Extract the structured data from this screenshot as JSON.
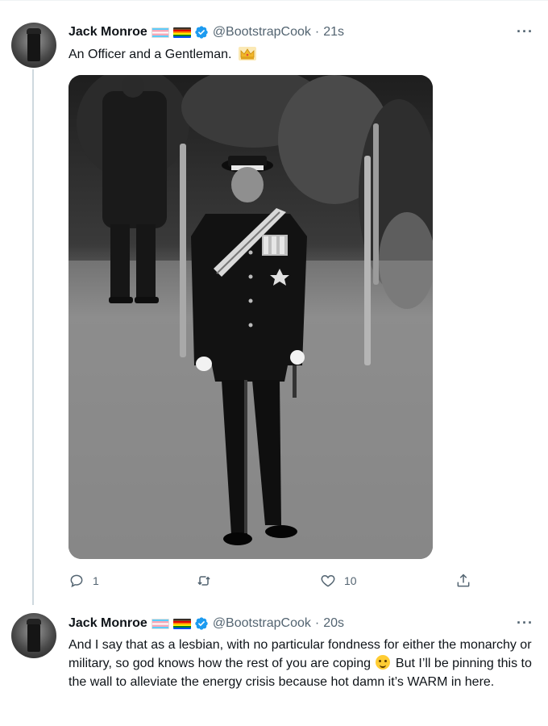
{
  "tweets": [
    {
      "author_name": "Jack Monroe",
      "handle": "@BootstrapCook",
      "timestamp": "21s",
      "text": "An Officer and a Gentleman.",
      "emoji": "crown-icon",
      "media": "photo-uniformed-officer-black-and-white",
      "actions": {
        "reply_count": "1",
        "retweet_count": "",
        "like_count": "10"
      }
    },
    {
      "author_name": "Jack Monroe",
      "handle": "@BootstrapCook",
      "timestamp": "20s",
      "text_before_emoji": "And I say that as a lesbian, with no particular fondness for either the monarchy or military, so god knows how the rest of you are coping",
      "text_after_emoji": "But I’ll be pinning this to the wall to alleviate the energy crisis because hot damn it’s WARM in here.",
      "emoji": "winking-tongue-face-icon"
    }
  ],
  "separator": "·",
  "more_label": "···",
  "colors": {
    "verified": "#1d9bf0",
    "text": "#0f1419",
    "secondary": "#536471",
    "thread_line": "#cfd9de"
  }
}
